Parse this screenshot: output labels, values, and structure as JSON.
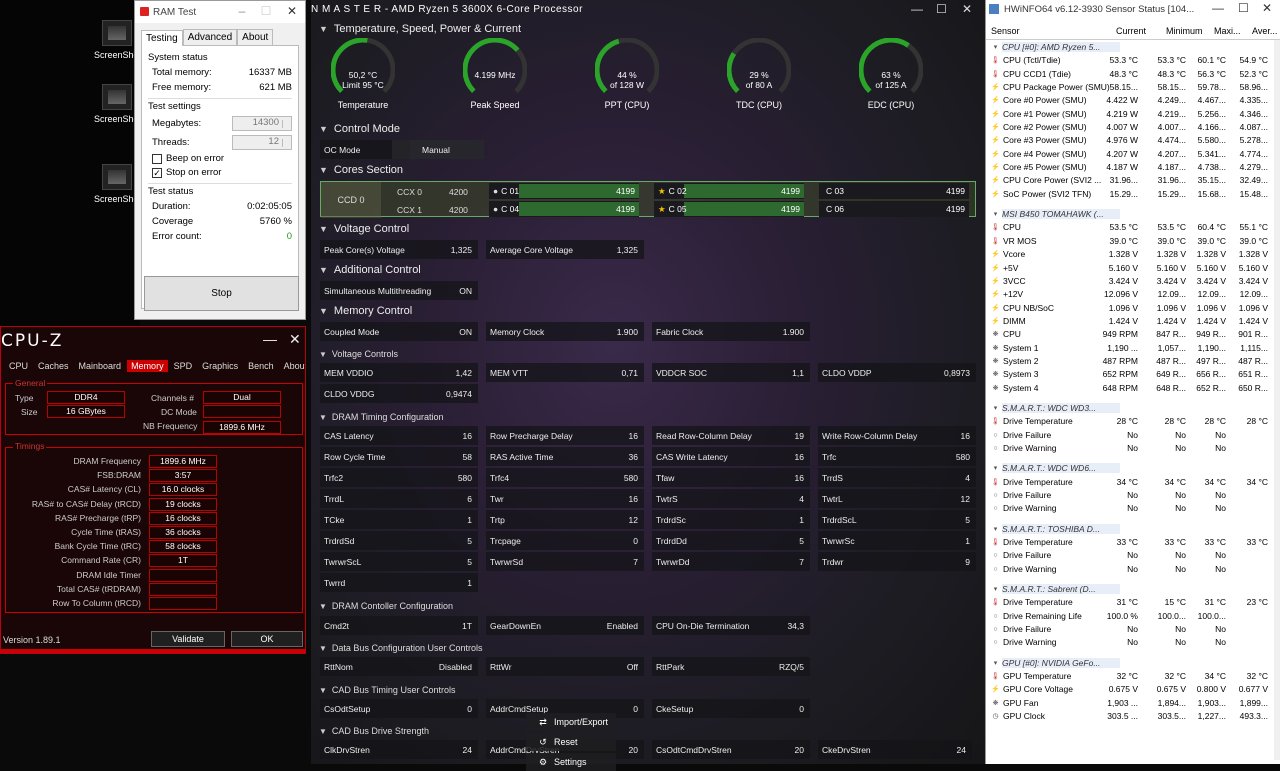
{
  "desktop": {
    "icons": [
      {
        "label": "ScreenSho"
      },
      {
        "label": "ScreenSho"
      },
      {
        "label": "ScreenSho"
      }
    ]
  },
  "ramtest": {
    "title": "RAM Test",
    "tabs": [
      "Testing",
      "Advanced",
      "About"
    ],
    "system_status": {
      "heading": "System status",
      "total_memory_label": "Total memory:",
      "total_memory": "16337 MB",
      "free_memory_label": "Free memory:",
      "free_memory": "621 MB"
    },
    "test_settings": {
      "heading": "Test settings",
      "megabytes_label": "Megabytes:",
      "megabytes": "14300",
      "threads_label": "Threads:",
      "threads": "12",
      "beep_label": "Beep on error",
      "beep_checked": false,
      "stop_label": "Stop on error",
      "stop_checked": true
    },
    "test_status": {
      "heading": "Test status",
      "duration_label": "Duration:",
      "duration": "0:02:05:05",
      "coverage_label": "Coverage",
      "coverage": "5760 %",
      "errors_label": "Error count:",
      "errors": "0"
    },
    "stop_button": "Stop"
  },
  "cpuz": {
    "logo": "CPU-Z",
    "tabs": [
      "CPU",
      "Caches",
      "Mainboard",
      "Memory",
      "SPD",
      "Graphics",
      "Bench",
      "About"
    ],
    "active_tab": "Memory",
    "general_heading": "General",
    "type_label": "Type",
    "type": "DDR4",
    "size_label": "Size",
    "size": "16 GBytes",
    "channels_label": "Channels #",
    "channels": "Dual",
    "dc_mode_label": "DC Mode",
    "dc_mode": "",
    "nb_freq_label": "NB Frequency",
    "nb_freq": "1899.6 MHz",
    "timings_heading": "Timings",
    "timings": [
      {
        "label": "DRAM Frequency",
        "value": "1899.6 MHz"
      },
      {
        "label": "FSB:DRAM",
        "value": "3:57"
      },
      {
        "label": "CAS# Latency (CL)",
        "value": "16.0 clocks"
      },
      {
        "label": "RAS# to CAS# Delay (tRCD)",
        "value": "19 clocks"
      },
      {
        "label": "RAS# Precharge (tRP)",
        "value": "16 clocks"
      },
      {
        "label": "Cycle Time (tRAS)",
        "value": "36 clocks"
      },
      {
        "label": "Bank Cycle Time (tRC)",
        "value": "58 clocks"
      },
      {
        "label": "Command Rate (CR)",
        "value": "1T"
      },
      {
        "label": "DRAM Idle Timer",
        "value": ""
      },
      {
        "label": "Total CAS# (tRDRAM)",
        "value": ""
      },
      {
        "label": "Row To Column (tRCD)",
        "value": ""
      }
    ],
    "version": "Version 1.89.1",
    "validate": "Validate",
    "ok": "OK"
  },
  "rm": {
    "title": "N  M A S T E R   -  AMD Ryzen 5 3600X 6-Core Processor",
    "sections": {
      "tsp": "Temperature, Speed, Power & Current",
      "control_mode": "Control Mode",
      "cores": "Cores Section",
      "voltage": "Voltage Control",
      "additional": "Additional Control",
      "memory": "Memory Control",
      "voltage_controls": "Voltage Controls",
      "dram_timing": "DRAM Timing Configuration",
      "dram_ctrl": "DRAM Contoller Configuration",
      "data_bus": "Data Bus Configuration User Controls",
      "cad_timing": "CAD Bus Timing User Controls",
      "cad_drive": "CAD Bus Drive Strength"
    },
    "gauges": [
      {
        "line1": "50,2 °C",
        "line2": "Limit 95 °C",
        "label": "Temperature",
        "fraction": 0.53
      },
      {
        "line1": "4.199  MHz",
        "line2": "",
        "label": "Peak Speed",
        "fraction": 0.68
      },
      {
        "line1": "44 %",
        "line2": "of 128 W",
        "label": "PPT (CPU)",
        "fraction": 0.44
      },
      {
        "line1": "29 %",
        "line2": "of 80 A",
        "label": "TDC (CPU)",
        "fraction": 0.29
      },
      {
        "line1": "63 %",
        "line2": "of 125 A",
        "label": "EDC (CPU)",
        "fraction": 0.63
      }
    ],
    "oc_mode_label": "OC Mode",
    "oc_mode": "Manual",
    "ccd": "CCD 0",
    "ccx": [
      {
        "name": "CCX 0",
        "freq": "4200",
        "cores": [
          {
            "name": "C 01",
            "freq": "4199",
            "icon": "●"
          },
          {
            "name": "C 02",
            "freq": "4199",
            "icon": "★"
          },
          {
            "name": "C 03",
            "freq": "4199",
            "icon": ""
          }
        ]
      },
      {
        "name": "CCX 1",
        "freq": "4200",
        "cores": [
          {
            "name": "C 04",
            "freq": "4199",
            "icon": "●"
          },
          {
            "name": "C 05",
            "freq": "4199",
            "icon": "★"
          },
          {
            "name": "C 06",
            "freq": "4199",
            "icon": ""
          }
        ]
      }
    ],
    "voltage_cells": [
      {
        "label": "Peak Core(s) Voltage",
        "value": "1,325"
      },
      {
        "label": "Average Core Voltage",
        "value": "1,325"
      }
    ],
    "smt": {
      "label": "Simultaneous Multithreading",
      "value": "ON"
    },
    "memory_cells": [
      {
        "label": "Coupled Mode",
        "value": "ON"
      },
      {
        "label": "Memory Clock",
        "value": "1.900"
      },
      {
        "label": "Fabric Clock",
        "value": "1.900"
      }
    ],
    "vctrl": [
      [
        {
          "label": "MEM VDDIO",
          "value": "1,42"
        },
        {
          "label": "MEM VTT",
          "value": "0,71"
        },
        {
          "label": "VDDCR SOC",
          "value": "1,1"
        },
        {
          "label": "CLDO VDDP",
          "value": "0,8973"
        }
      ],
      [
        {
          "label": "CLDO VDDG",
          "value": "0,9474"
        }
      ]
    ],
    "timing_rows": [
      [
        {
          "label": "CAS Latency",
          "value": "16"
        },
        {
          "label": "Row Precharge Delay",
          "value": "16"
        },
        {
          "label": "Read Row-Column Delay",
          "value": "19"
        },
        {
          "label": "Write Row-Column Delay",
          "value": "16"
        }
      ],
      [
        {
          "label": "Row Cycle Time",
          "value": "58"
        },
        {
          "label": "RAS Active Time",
          "value": "36"
        },
        {
          "label": "CAS Write Latency",
          "value": "16"
        },
        {
          "label": "Trfc",
          "value": "580"
        }
      ],
      [
        {
          "label": "Trfc2",
          "value": "580"
        },
        {
          "label": "Trfc4",
          "value": "580"
        },
        {
          "label": "Tfaw",
          "value": "16"
        },
        {
          "label": "TrrdS",
          "value": "4"
        }
      ],
      [
        {
          "label": "TrrdL",
          "value": "6"
        },
        {
          "label": "Twr",
          "value": "16"
        },
        {
          "label": "TwtrS",
          "value": "4"
        },
        {
          "label": "TwtrL",
          "value": "12"
        }
      ],
      [
        {
          "label": "TCke",
          "value": "1"
        },
        {
          "label": "Trtp",
          "value": "12"
        },
        {
          "label": "TrdrdSc",
          "value": "1"
        },
        {
          "label": "TrdrdScL",
          "value": "5"
        }
      ],
      [
        {
          "label": "TrdrdSd",
          "value": "5"
        },
        {
          "label": "Trcpage",
          "value": "0"
        },
        {
          "label": "TrdrdDd",
          "value": "5"
        },
        {
          "label": "TwrwrSc",
          "value": "1"
        }
      ],
      [
        {
          "label": "TwrwrScL",
          "value": "5"
        },
        {
          "label": "TwrwrSd",
          "value": "7"
        },
        {
          "label": "TwrwrDd",
          "value": "7"
        },
        {
          "label": "Trdwr",
          "value": "9"
        }
      ],
      [
        {
          "label": "Twrrd",
          "value": "1"
        }
      ]
    ],
    "dram_ctrl_cells": [
      {
        "label": "Cmd2t",
        "value": "1T"
      },
      {
        "label": "GearDownEn",
        "value": "Enabled"
      },
      {
        "label": "CPU On-Die Termination",
        "value": "34,3"
      }
    ],
    "data_bus_cells": [
      {
        "label": "RttNom",
        "value": "Disabled"
      },
      {
        "label": "RttWr",
        "value": "Off"
      },
      {
        "label": "RttPark",
        "value": "RZQ/5"
      }
    ],
    "cad_timing_cells": [
      {
        "label": "CsOdtSetup",
        "value": "0"
      },
      {
        "label": "AddrCmdSetup",
        "value": "0"
      },
      {
        "label": "CkeSetup",
        "value": "0"
      }
    ],
    "cad_drive_cells": [
      {
        "label": "ClkDrvStren",
        "value": "24"
      },
      {
        "label": "AddrCmdDrvStren",
        "value": "20"
      },
      {
        "label": "CsOdtCmdDrvStren",
        "value": "20"
      },
      {
        "label": "CkeDrvStren",
        "value": "24"
      }
    ],
    "side_menu": [
      {
        "label": "Import/Export"
      },
      {
        "label": "Reset"
      },
      {
        "label": "Settings"
      }
    ]
  },
  "hw": {
    "title": "HWiNFO64 v6.12-3930 Sensor Status [104...",
    "columns": [
      "Sensor",
      "Current",
      "Minimum",
      "Maxi...",
      "Aver..."
    ],
    "rows": [
      {
        "t": "g",
        "name": "CPU [#0]: AMD Ryzen 5..."
      },
      {
        "t": "temp",
        "name": "CPU (Tctl/Tdie)",
        "v": [
          "53.3 °C",
          "53.3 °C",
          "60.1 °C",
          "54.9 °C"
        ]
      },
      {
        "t": "temp",
        "name": "CPU CCD1 (Tdie)",
        "v": [
          "48.3 °C",
          "48.3 °C",
          "56.3 °C",
          "52.3 °C"
        ]
      },
      {
        "t": "power",
        "name": "CPU Package Power (SMU)",
        "v": [
          "58.15...",
          "58.15...",
          "59.78...",
          "58.96..."
        ]
      },
      {
        "t": "power",
        "name": "Core #0 Power (SMU)",
        "v": [
          "4.422 W",
          "4.249...",
          "4.467...",
          "4.335..."
        ]
      },
      {
        "t": "power",
        "name": "Core #1 Power (SMU)",
        "v": [
          "4.219 W",
          "4.219...",
          "5.256...",
          "4.346..."
        ]
      },
      {
        "t": "power",
        "name": "Core #2 Power (SMU)",
        "v": [
          "4.007 W",
          "4.007...",
          "4.166...",
          "4.087..."
        ]
      },
      {
        "t": "power",
        "name": "Core #3 Power (SMU)",
        "v": [
          "4.976 W",
          "4.474...",
          "5.580...",
          "5.278..."
        ]
      },
      {
        "t": "power",
        "name": "Core #4 Power (SMU)",
        "v": [
          "4.207 W",
          "4.207...",
          "5.341...",
          "4.774..."
        ]
      },
      {
        "t": "power",
        "name": "Core #5 Power (SMU)",
        "v": [
          "4.187 W",
          "4.187...",
          "4.738...",
          "4.279..."
        ]
      },
      {
        "t": "power",
        "name": "CPU Core Power (SVI2 ...",
        "v": [
          "31.96...",
          "31.96...",
          "35.15...",
          "32.49..."
        ]
      },
      {
        "t": "power",
        "name": "SoC Power (SVI2 TFN)",
        "v": [
          "15.29...",
          "15.29...",
          "15.68...",
          "15.48..."
        ]
      },
      {
        "t": "gap"
      },
      {
        "t": "g",
        "name": "MSI B450 TOMAHAWK (..."
      },
      {
        "t": "temp",
        "name": "CPU",
        "v": [
          "53.5 °C",
          "53.5 °C",
          "60.4 °C",
          "55.1 °C"
        ]
      },
      {
        "t": "temp",
        "name": "VR MOS",
        "v": [
          "39.0 °C",
          "39.0 °C",
          "39.0 °C",
          "39.0 °C"
        ]
      },
      {
        "t": "volt",
        "name": "Vcore",
        "v": [
          "1.328 V",
          "1.328 V",
          "1.328 V",
          "1.328 V"
        ]
      },
      {
        "t": "volt",
        "name": "+5V",
        "v": [
          "5.160 V",
          "5.160 V",
          "5.160 V",
          "5.160 V"
        ]
      },
      {
        "t": "volt",
        "name": "3VCC",
        "v": [
          "3.424 V",
          "3.424 V",
          "3.424 V",
          "3.424 V"
        ]
      },
      {
        "t": "volt",
        "name": "+12V",
        "v": [
          "12.096 V",
          "12.09...",
          "12.09...",
          "12.09..."
        ]
      },
      {
        "t": "volt",
        "name": "CPU NB/SoC",
        "v": [
          "1.096 V",
          "1.096 V",
          "1.096 V",
          "1.096 V"
        ]
      },
      {
        "t": "volt",
        "name": "DIMM",
        "v": [
          "1.424 V",
          "1.424 V",
          "1.424 V",
          "1.424 V"
        ]
      },
      {
        "t": "fan",
        "name": "CPU",
        "v": [
          "949 RPM",
          "847 R...",
          "949 R...",
          "901 R..."
        ]
      },
      {
        "t": "fan",
        "name": "System 1",
        "v": [
          "1,190 ...",
          "1,057...",
          "1,190...",
          "1,115..."
        ]
      },
      {
        "t": "fan",
        "name": "System 2",
        "v": [
          "487 RPM",
          "487 R...",
          "497 R...",
          "487 R..."
        ]
      },
      {
        "t": "fan",
        "name": "System 3",
        "v": [
          "652 RPM",
          "649 R...",
          "656 R...",
          "651 R..."
        ]
      },
      {
        "t": "fan",
        "name": "System 4",
        "v": [
          "648 RPM",
          "648 R...",
          "652 R...",
          "650 R..."
        ]
      },
      {
        "t": "gap"
      },
      {
        "t": "g",
        "name": "S.M.A.R.T.: WDC WD3..."
      },
      {
        "t": "temp",
        "name": "Drive Temperature",
        "v": [
          "28 °C",
          "28 °C",
          "28 °C",
          "28 °C"
        ]
      },
      {
        "t": "status",
        "name": "Drive Failure",
        "v": [
          "No",
          "No",
          "No",
          ""
        ]
      },
      {
        "t": "status",
        "name": "Drive Warning",
        "v": [
          "No",
          "No",
          "No",
          ""
        ]
      },
      {
        "t": "gap"
      },
      {
        "t": "g",
        "name": "S.M.A.R.T.: WDC WD6..."
      },
      {
        "t": "temp",
        "name": "Drive Temperature",
        "v": [
          "34 °C",
          "34 °C",
          "34 °C",
          "34 °C"
        ]
      },
      {
        "t": "status",
        "name": "Drive Failure",
        "v": [
          "No",
          "No",
          "No",
          ""
        ]
      },
      {
        "t": "status",
        "name": "Drive Warning",
        "v": [
          "No",
          "No",
          "No",
          ""
        ]
      },
      {
        "t": "gap"
      },
      {
        "t": "g",
        "name": "S.M.A.R.T.: TOSHIBA D..."
      },
      {
        "t": "temp",
        "name": "Drive Temperature",
        "v": [
          "33 °C",
          "33 °C",
          "33 °C",
          "33 °C"
        ]
      },
      {
        "t": "status",
        "name": "Drive Failure",
        "v": [
          "No",
          "No",
          "No",
          ""
        ]
      },
      {
        "t": "status",
        "name": "Drive Warning",
        "v": [
          "No",
          "No",
          "No",
          ""
        ]
      },
      {
        "t": "gap"
      },
      {
        "t": "g",
        "name": "S.M.A.R.T.: Sabrent (D..."
      },
      {
        "t": "temp",
        "name": "Drive Temperature",
        "v": [
          "31 °C",
          "15 °C",
          "31 °C",
          "23 °C"
        ]
      },
      {
        "t": "status",
        "name": "Drive Remaining Life",
        "v": [
          "100.0 %",
          "100.0...",
          "100.0...",
          ""
        ]
      },
      {
        "t": "status",
        "name": "Drive Failure",
        "v": [
          "No",
          "No",
          "No",
          ""
        ]
      },
      {
        "t": "status",
        "name": "Drive Warning",
        "v": [
          "No",
          "No",
          "No",
          ""
        ]
      },
      {
        "t": "gap"
      },
      {
        "t": "g",
        "name": "GPU [#0]: NVIDIA GeFo..."
      },
      {
        "t": "temp",
        "name": "GPU Temperature",
        "v": [
          "32 °C",
          "32 °C",
          "34 °C",
          "32 °C"
        ]
      },
      {
        "t": "volt",
        "name": "GPU Core Voltage",
        "v": [
          "0.675 V",
          "0.675 V",
          "0.800 V",
          "0.677 V"
        ]
      },
      {
        "t": "fan",
        "name": "GPU Fan",
        "v": [
          "1,903 ...",
          "1,894...",
          "1,903...",
          "1,899..."
        ]
      },
      {
        "t": "clock",
        "name": "GPU Clock",
        "v": [
          "303.5 ...",
          "303.5...",
          "1,227...",
          "493.3..."
        ]
      }
    ]
  }
}
